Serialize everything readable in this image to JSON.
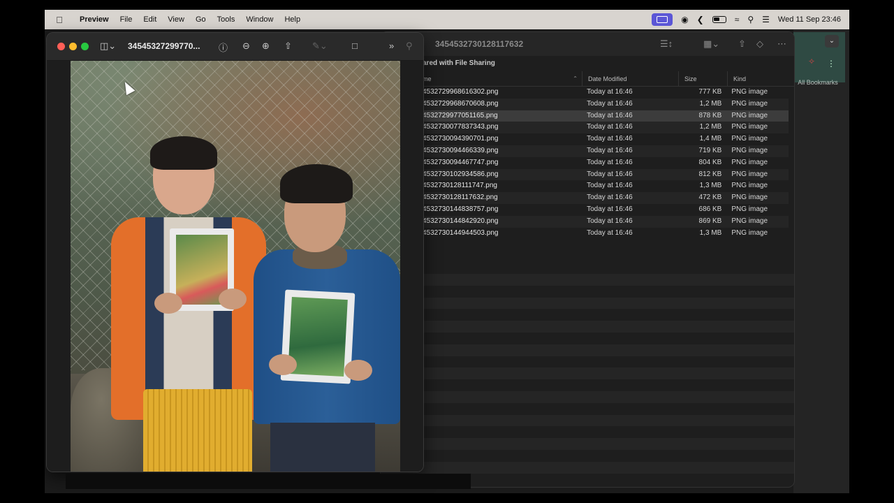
{
  "menubar": {
    "apple_icon": "apple-icon",
    "app_name": "Preview",
    "menus": [
      "File",
      "Edit",
      "View",
      "Go",
      "Tools",
      "Window",
      "Help"
    ],
    "datetime": "Wed 11 Sep  23:46"
  },
  "preview": {
    "title": "345453272997​70...",
    "title_display": "34545327299770..."
  },
  "finder": {
    "title": "3454532730128117632",
    "path_label": "ared with File Sharing",
    "columns": {
      "name": "me",
      "date": "Date Modified",
      "size": "Size",
      "kind": "Kind"
    },
    "files": [
      {
        "name": "4532729968616302.png",
        "date": "Today at 16:46",
        "size": "777 KB",
        "kind": "PNG image"
      },
      {
        "name": "4532729968670608.png",
        "date": "Today at 16:46",
        "size": "1,2 MB",
        "kind": "PNG image"
      },
      {
        "name": "4532729977051165.png",
        "date": "Today at 16:46",
        "size": "878 KB",
        "kind": "PNG image"
      },
      {
        "name": "4532730077837343.png",
        "date": "Today at 16:46",
        "size": "1,2 MB",
        "kind": "PNG image"
      },
      {
        "name": "4532730094390701.png",
        "date": "Today at 16:46",
        "size": "1,4 MB",
        "kind": "PNG image"
      },
      {
        "name": "4532730094466339.png",
        "date": "Today at 16:46",
        "size": "719 KB",
        "kind": "PNG image"
      },
      {
        "name": "4532730094467747.png",
        "date": "Today at 16:46",
        "size": "804 KB",
        "kind": "PNG image"
      },
      {
        "name": "4532730102934586.png",
        "date": "Today at 16:46",
        "size": "812 KB",
        "kind": "PNG image"
      },
      {
        "name": "4532730128111747.png",
        "date": "Today at 16:46",
        "size": "1,3 MB",
        "kind": "PNG image"
      },
      {
        "name": "4532730128117632.png",
        "date": "Today at 16:46",
        "size": "472 KB",
        "kind": "PNG image"
      },
      {
        "name": "4532730144838757.png",
        "date": "Today at 16:46",
        "size": "686 KB",
        "kind": "PNG image"
      },
      {
        "name": "4532730144842920.png",
        "date": "Today at 16:46",
        "size": "869 KB",
        "kind": "PNG image"
      },
      {
        "name": "4532730144944503.png",
        "date": "Today at 16:46",
        "size": "1,3 MB",
        "kind": "PNG image"
      }
    ]
  },
  "sidebar": {
    "bookmarks_label": "All Bookmarks"
  },
  "colors": {
    "menubar_bg": "#d8d4cf",
    "accent_badge": "#5b56d6",
    "window_bg": "#1e1e1e"
  }
}
